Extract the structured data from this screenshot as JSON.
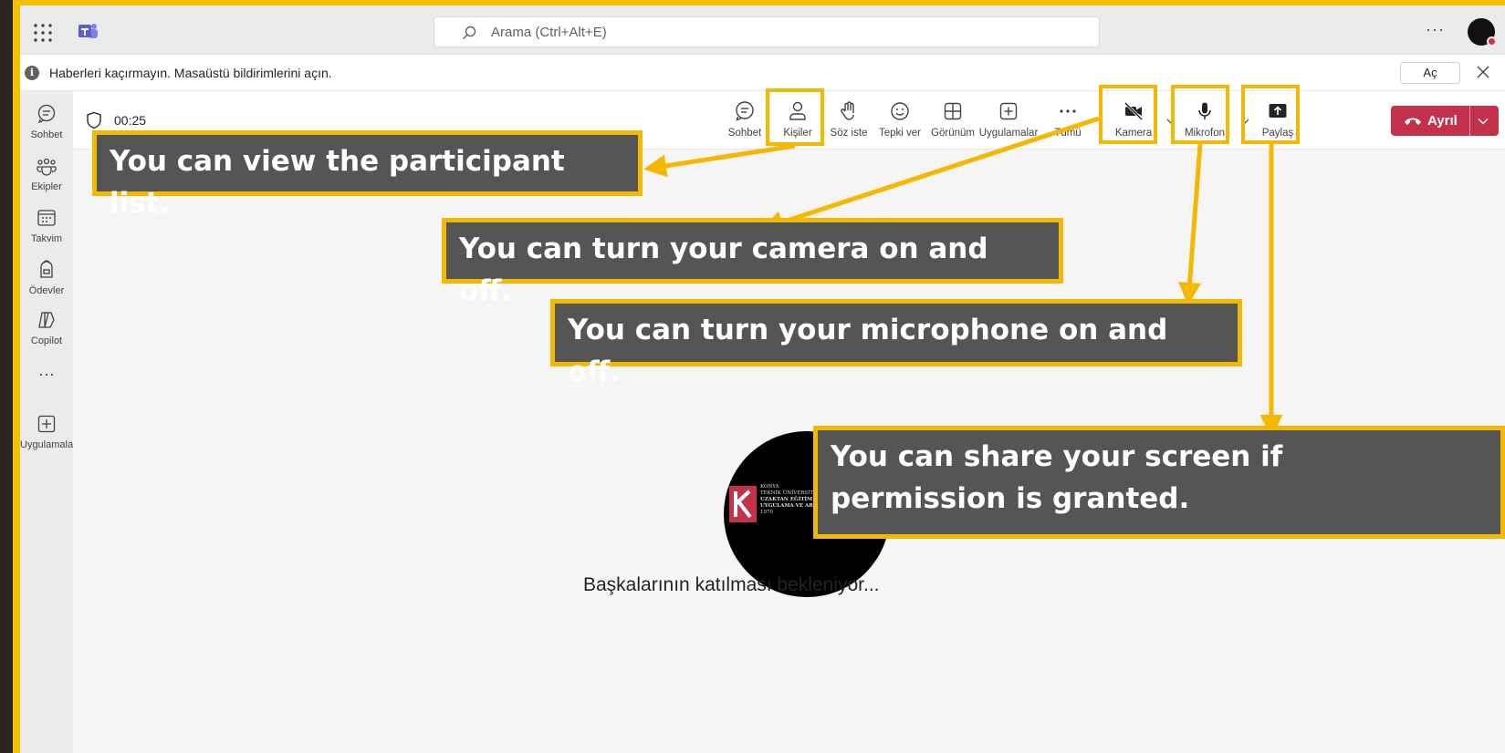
{
  "search": {
    "placeholder": "Arama (Ctrl+Alt+E)"
  },
  "topbar": {
    "more": "···"
  },
  "notification": {
    "message": "Haberleri kaçırmayın. Masaüstü bildirimlerini açın.",
    "open_label": "Aç"
  },
  "rail": {
    "items": [
      {
        "label": "Sohbet"
      },
      {
        "label": "Ekipler"
      },
      {
        "label": "Takvim"
      },
      {
        "label": "Ödevler"
      },
      {
        "label": "Copilot"
      },
      {
        "label": "Uygulamalar"
      }
    ],
    "more": "···"
  },
  "call": {
    "timer": "00:25",
    "buttons": {
      "chat": "Sohbet",
      "people": "Kişiler",
      "raise_hand": "Söz iste",
      "react": "Tepki ver",
      "view": "Görünüm",
      "apps": "Uygulamalar",
      "more": "Tümü",
      "camera": "Kamera",
      "mic": "Mikrofon",
      "share": "Paylaş"
    },
    "leave_label": "Ayrıl",
    "waiting_text": "Başkalarının katılması bekleniyor..."
  },
  "logo": {
    "lines": [
      "KONYA",
      "TEKNİK ÜNİVERSİTESİ",
      "UZAKTAN EĞİTİM",
      "UYGULAMA VE ARAŞTIRMA MERKEZİ",
      "1970"
    ]
  },
  "annotations": {
    "participants": "You can view the participant list.",
    "camera": "You can turn your camera on and off.",
    "microphone": "You can turn your microphone on and off.",
    "share_line1": "You can share your screen if",
    "share_line2": "permission is granted."
  },
  "colors": {
    "highlight": "#f5b800",
    "callout_bg": "#555555",
    "leave": "#c4314b",
    "teams": "#5b5fc7"
  }
}
